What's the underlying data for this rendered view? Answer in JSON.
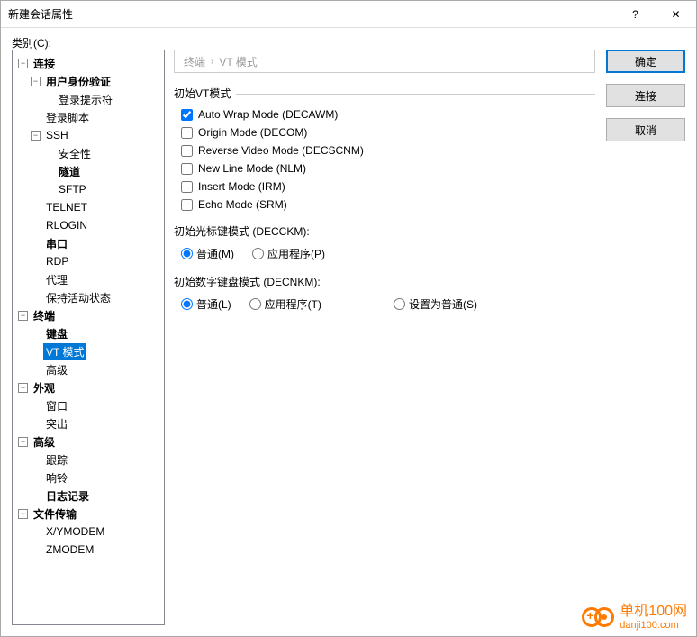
{
  "window": {
    "title": "新建会话属性",
    "help": "?",
    "close": "✕"
  },
  "category_label": "类别(C):",
  "tree": {
    "connection": "连接",
    "user_auth": "用户身份验证",
    "login_prompt": "登录提示符",
    "login_script": "登录脚本",
    "ssh": "SSH",
    "security": "安全性",
    "tunnel": "隧道",
    "sftp": "SFTP",
    "telnet": "TELNET",
    "rlogin": "RLOGIN",
    "serial": "串口",
    "rdp": "RDP",
    "proxy": "代理",
    "keepalive": "保持活动状态",
    "terminal": "终端",
    "keyboard": "键盘",
    "vtmode": "VT 模式",
    "advanced_term": "高级",
    "appearance": "外观",
    "window": "窗口",
    "highlight": "突出",
    "advanced": "高级",
    "trace": "跟踪",
    "bell": "响铃",
    "logging": "日志记录",
    "filetransfer": "文件传输",
    "xymodem": "X/YMODEM",
    "zmodem": "ZMODEM"
  },
  "breadcrumb": {
    "a": "终端",
    "b": "VT 模式"
  },
  "buttons": {
    "ok": "确定",
    "connect": "连接",
    "cancel": "取消"
  },
  "group": {
    "initial_vt": "初始VT模式"
  },
  "checks": {
    "awm": "Auto Wrap Mode (DECAWM)",
    "om": "Origin Mode (DECOM)",
    "rvm": "Reverse Video Mode (DECSCNM)",
    "nlm": "New Line Mode (NLM)",
    "irm": "Insert Mode (IRM)",
    "erm": "Echo Mode (SRM)"
  },
  "cursor": {
    "label": "初始光标键模式 (DECCKM):",
    "normal": "普通(M)",
    "app": "应用程序(P)"
  },
  "keypad": {
    "label": "初始数字键盘模式 (DECNKM):",
    "normal": "普通(L)",
    "app": "应用程序(T)",
    "setnormal": "设置为普通(S)"
  },
  "watermark": {
    "text": "单机100网",
    "url": "danji100.com"
  }
}
